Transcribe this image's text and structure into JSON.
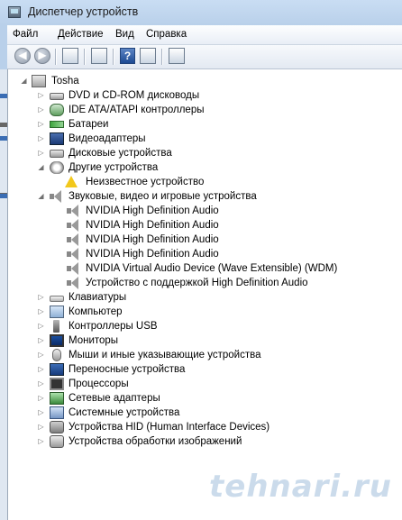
{
  "window": {
    "title": "Диспетчер устройств"
  },
  "menu": [
    "Файл",
    "Действие",
    "Вид",
    "Справка"
  ],
  "toolbar": {
    "buttons": [
      "back-arrow",
      "forward-arrow",
      "show-hide-tree",
      "properties",
      "help",
      "run-action",
      "scan-hardware"
    ],
    "help_glyph": "?"
  },
  "tree": {
    "root": "Tosha",
    "categories": [
      {
        "label": "DVD и CD-ROM дисководы",
        "icon": "disk-drive-icon",
        "expanded": false
      },
      {
        "label": "IDE ATA/ATAPI контроллеры",
        "icon": "ide-controller-icon",
        "expanded": false
      },
      {
        "label": "Батареи",
        "icon": "battery-icon",
        "expanded": false
      },
      {
        "label": "Видеоадаптеры",
        "icon": "display-adapter-icon",
        "expanded": false
      },
      {
        "label": "Дисковые устройства",
        "icon": "hard-disk-icon",
        "expanded": false
      },
      {
        "label": "Другие устройства",
        "icon": "other-devices-icon",
        "expanded": true,
        "children": [
          {
            "label": "Неизвестное устройство",
            "icon": "warning-icon"
          }
        ]
      },
      {
        "label": "Звуковые, видео и игровые устройства",
        "icon": "speaker-icon",
        "expanded": true,
        "children": [
          {
            "label": "NVIDIA High Definition Audio",
            "icon": "speaker-icon"
          },
          {
            "label": "NVIDIA High Definition Audio",
            "icon": "speaker-icon"
          },
          {
            "label": "NVIDIA High Definition Audio",
            "icon": "speaker-icon"
          },
          {
            "label": "NVIDIA High Definition Audio",
            "icon": "speaker-icon"
          },
          {
            "label": "NVIDIA Virtual Audio Device (Wave Extensible) (WDM)",
            "icon": "speaker-icon"
          },
          {
            "label": "Устройство с поддержкой High Definition Audio",
            "icon": "speaker-icon"
          }
        ]
      },
      {
        "label": "Клавиатуры",
        "icon": "keyboard-icon",
        "expanded": false
      },
      {
        "label": "Компьютер",
        "icon": "computer-icon",
        "expanded": false
      },
      {
        "label": "Контроллеры USB",
        "icon": "usb-icon",
        "expanded": false
      },
      {
        "label": "Мониторы",
        "icon": "monitor-icon",
        "expanded": false
      },
      {
        "label": "Мыши и иные указывающие устройства",
        "icon": "mouse-icon",
        "expanded": false
      },
      {
        "label": "Переносные устройства",
        "icon": "portable-device-icon",
        "expanded": false
      },
      {
        "label": "Процессоры",
        "icon": "processor-icon",
        "expanded": false
      },
      {
        "label": "Сетевые адаптеры",
        "icon": "network-adapter-icon",
        "expanded": false
      },
      {
        "label": "Системные устройства",
        "icon": "system-device-icon",
        "expanded": false
      },
      {
        "label": "Устройства HID (Human Interface Devices)",
        "icon": "hid-icon",
        "expanded": false
      },
      {
        "label": "Устройства обработки изображений",
        "icon": "imaging-device-icon",
        "expanded": false
      }
    ]
  },
  "watermark": "tehnari.ru"
}
